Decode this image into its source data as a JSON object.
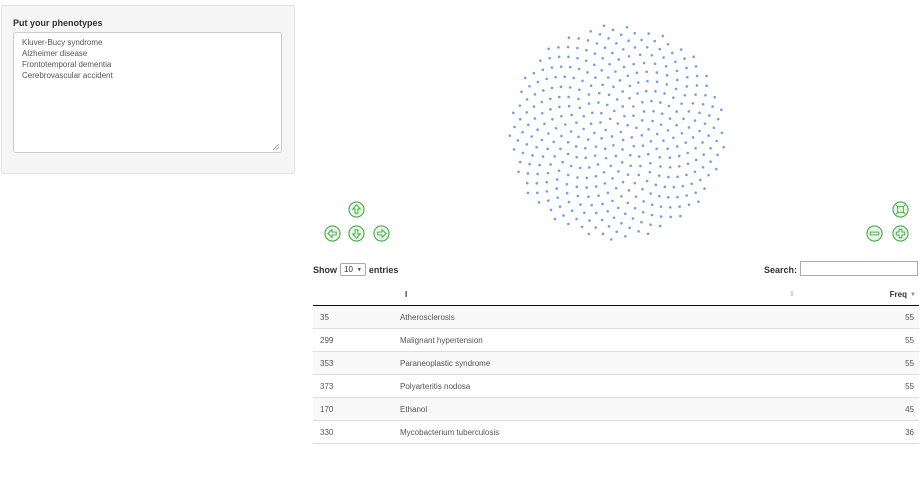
{
  "input_panel": {
    "label": "Put your phenotypes",
    "phenotypes": [
      "Kluver-Bucy syndrome",
      "Alzheimer disease",
      "Frontotemporal dementia",
      "Cerebrovascular accident"
    ]
  },
  "colors": {
    "node": "#6e9ef0",
    "nav_green": "#4aa84a",
    "nav_fill": "#e8f7e8"
  },
  "network": {
    "node_count": 400,
    "node_shape": "dot"
  },
  "navigation": {
    "buttons": [
      {
        "name": "nav-up-button",
        "icon": "arrow-up-icon"
      },
      {
        "name": "nav-left-button",
        "icon": "arrow-left-icon"
      },
      {
        "name": "nav-down-button",
        "icon": "arrow-down-icon"
      },
      {
        "name": "nav-right-button",
        "icon": "arrow-right-icon"
      },
      {
        "name": "zoom-extend-button",
        "icon": "zoom-extend-icon"
      },
      {
        "name": "zoom-out-button",
        "icon": "minus-icon"
      },
      {
        "name": "zoom-in-button",
        "icon": "plus-icon"
      }
    ]
  },
  "table_controls": {
    "show_label": "Show",
    "entries_value": "10",
    "entries_label": "entries",
    "search_label": "Search:",
    "search_value": ""
  },
  "table": {
    "columns": [
      "",
      "I",
      "Freq"
    ],
    "rows": [
      {
        "idx": "35",
        "name": "Atherosclerosis",
        "freq": "55"
      },
      {
        "idx": "299",
        "name": "Malignant hypertension",
        "freq": "55"
      },
      {
        "idx": "353",
        "name": "Paraneoplastic syndrome",
        "freq": "55"
      },
      {
        "idx": "373",
        "name": "Polyarteritis nodosa",
        "freq": "55"
      },
      {
        "idx": "170",
        "name": "Ethanol",
        "freq": "45"
      },
      {
        "idx": "330",
        "name": "Mycobacterium tuberculosis",
        "freq": "36"
      }
    ]
  }
}
